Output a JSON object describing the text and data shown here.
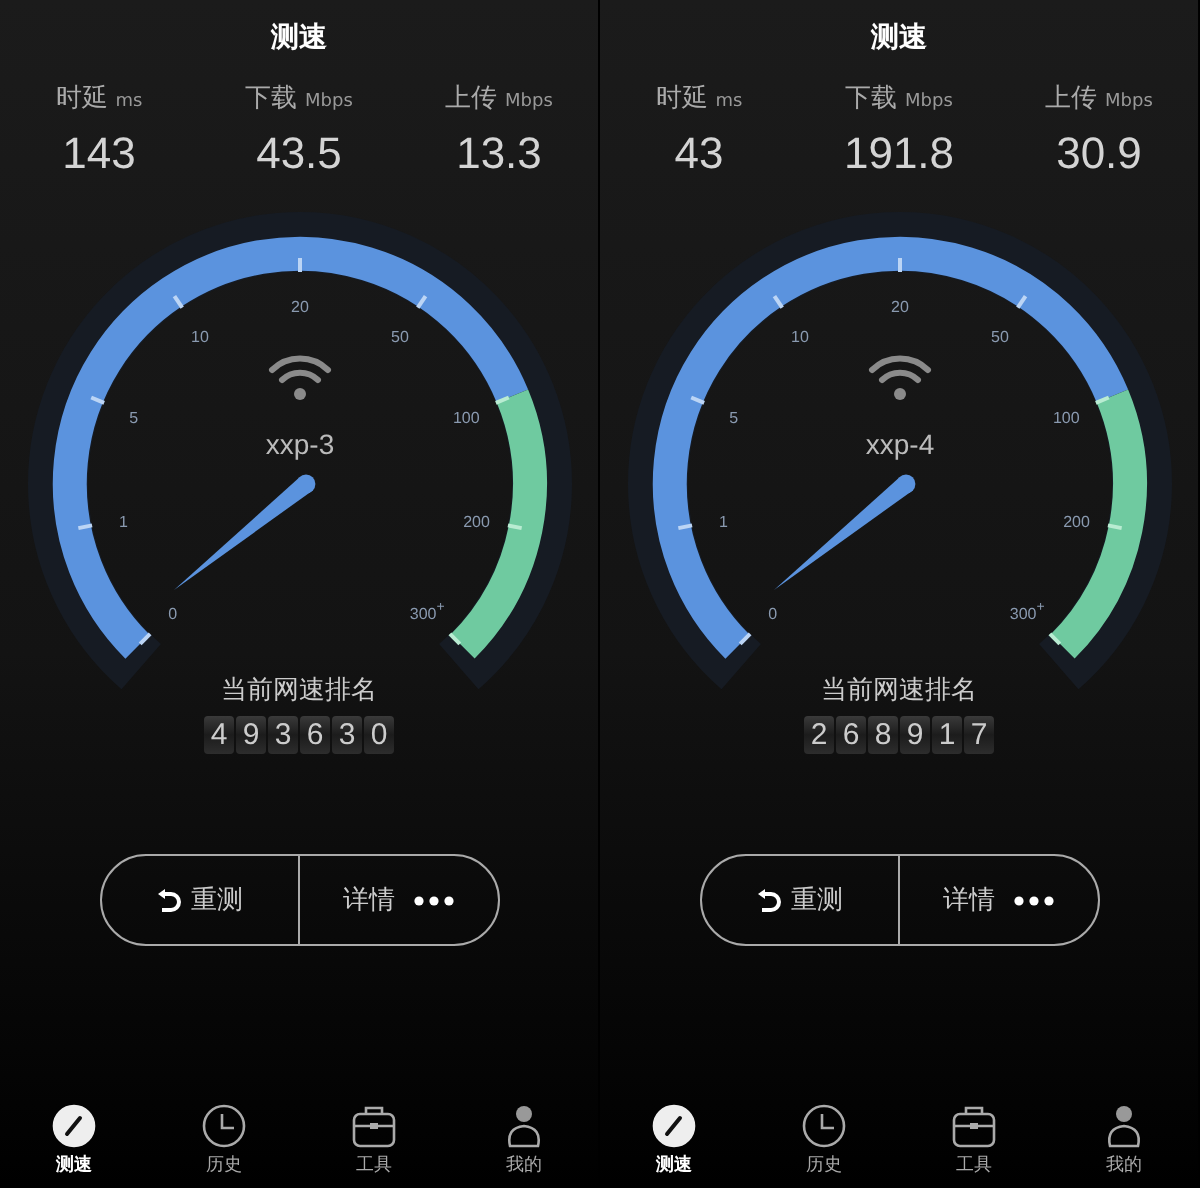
{
  "panels": [
    {
      "title": "测速",
      "metrics": [
        {
          "label": "时延",
          "unit": "ms",
          "value": "143"
        },
        {
          "label": "下载",
          "unit": "Mbps",
          "value": "43.5"
        },
        {
          "label": "上传",
          "unit": "Mbps",
          "value": "13.3"
        }
      ],
      "gauge": {
        "ticks": [
          "0",
          "1",
          "5",
          "10",
          "20",
          "50",
          "100",
          "200",
          "300$^{+}$"
        ],
        "ssid": "xxp-3"
      },
      "rank_label": "当前网速排名",
      "rank_digits": [
        "4",
        "9",
        "3",
        "6",
        "3",
        "0"
      ],
      "buttons": [
        {
          "kind": "retest",
          "label": "重测"
        },
        {
          "kind": "details",
          "label": "详情"
        }
      ],
      "tabs": [
        {
          "kind": "gauge",
          "label": "测速",
          "selected": true
        },
        {
          "kind": "clock",
          "label": "历史",
          "selected": false
        },
        {
          "kind": "briefcase",
          "label": "工具",
          "selected": false
        },
        {
          "kind": "person",
          "label": "我的",
          "selected": false
        }
      ]
    },
    {
      "title": "测速",
      "metrics": [
        {
          "label": "时延",
          "unit": "ms",
          "value": "43"
        },
        {
          "label": "下载",
          "unit": "Mbps",
          "value": "191.8"
        },
        {
          "label": "上传",
          "unit": "Mbps",
          "value": "30.9"
        }
      ],
      "gauge": {
        "ticks": [
          "0",
          "1",
          "5",
          "10",
          "20",
          "50",
          "100",
          "200",
          "300$^{+}$"
        ],
        "ssid": "xxp-4"
      },
      "rank_label": "当前网速排名",
      "rank_digits": [
        "2",
        "6",
        "8",
        "9",
        "1",
        "7"
      ],
      "buttons": [
        {
          "kind": "retest",
          "label": "重测"
        },
        {
          "kind": "details",
          "label": "详情"
        }
      ],
      "tabs": [
        {
          "kind": "gauge",
          "label": "测速",
          "selected": true
        },
        {
          "kind": "clock",
          "label": "历史",
          "selected": false
        },
        {
          "kind": "briefcase",
          "label": "工具",
          "selected": false
        },
        {
          "kind": "person",
          "label": "我的",
          "selected": false
        }
      ]
    }
  ]
}
